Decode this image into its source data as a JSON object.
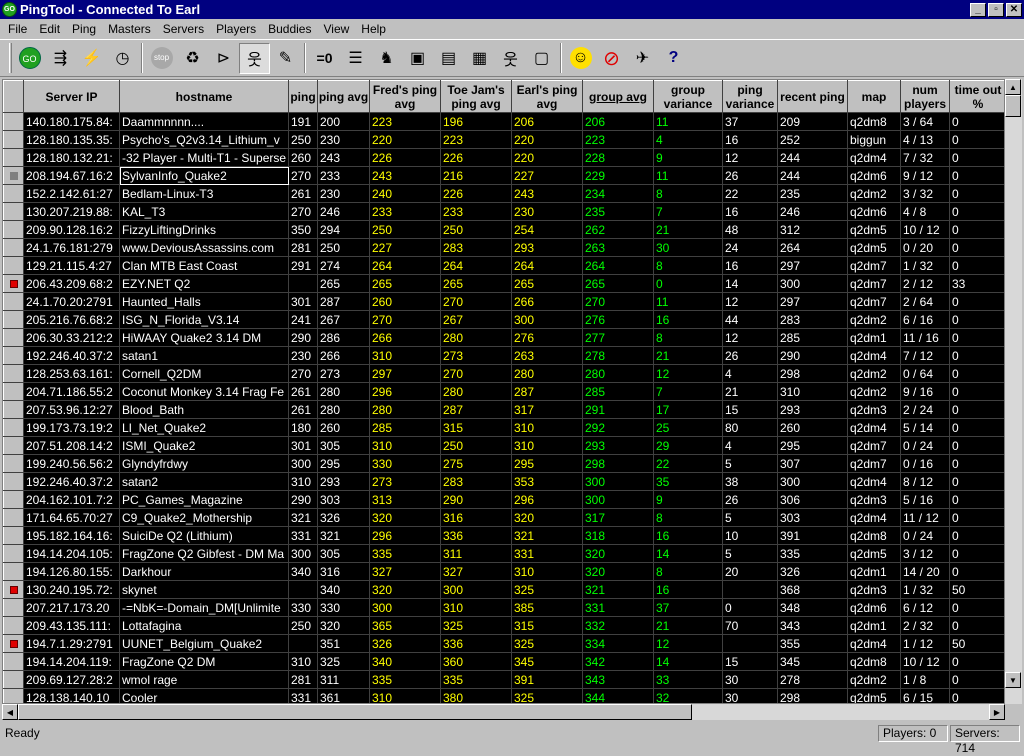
{
  "window": {
    "title": "PingTool - Connected To Earl",
    "app_icon": "GO",
    "minimize": "_",
    "maximize": "▫",
    "close": "✕"
  },
  "menu": [
    "File",
    "Edit",
    "Ping",
    "Masters",
    "Servers",
    "Players",
    "Buddies",
    "View",
    "Help"
  ],
  "toolbar": [
    {
      "name": "go-icon",
      "glyph": "GO"
    },
    {
      "name": "connect-network-icon",
      "glyph": "⇶"
    },
    {
      "name": "ping-lightning-icon",
      "glyph": "⚡"
    },
    {
      "name": "timer-icon",
      "glyph": "◷"
    },
    {
      "name": "stop-icon",
      "glyph": "stop"
    },
    {
      "name": "refresh-recycle-icon",
      "glyph": "♻"
    },
    {
      "name": "filter-icon",
      "glyph": "⊳"
    },
    {
      "name": "players-icon",
      "glyph": "웃"
    },
    {
      "name": "edit-pencil-icon",
      "glyph": "✎"
    },
    {
      "name": "zero-count-icon",
      "glyph": "=0"
    },
    {
      "name": "columns-icon",
      "glyph": "☰"
    },
    {
      "name": "binoculars-icon",
      "glyph": "♞"
    },
    {
      "name": "server-icon",
      "glyph": "▣"
    },
    {
      "name": "ping-server-icon",
      "glyph": "▤"
    },
    {
      "name": "window-icon",
      "glyph": "▦"
    },
    {
      "name": "group-players-icon",
      "glyph": "웃"
    },
    {
      "name": "monitor-icon",
      "glyph": "▢"
    },
    {
      "name": "smiley-icon",
      "glyph": "☺"
    },
    {
      "name": "no-buddy-icon",
      "glyph": "⊘"
    },
    {
      "name": "plane-icon",
      "glyph": "✈"
    },
    {
      "name": "help-icon",
      "glyph": "?"
    }
  ],
  "columns": [
    "",
    "Server IP",
    "hostname",
    "ping",
    "ping avg",
    "Fred's ping avg",
    "Toe Jam's ping avg",
    "Earl's ping avg",
    "group avg",
    "group variance",
    "ping variance",
    "recent ping",
    "map",
    "num players",
    "time out %"
  ],
  "rows": [
    [
      "",
      "140.180.175.84:",
      "Daammnnnn....",
      "191",
      "200",
      "223",
      "196",
      "206",
      "206",
      "11",
      "37",
      "209",
      "q2dm8",
      "3 / 64",
      "0"
    ],
    [
      "",
      "128.180.135.35:",
      "Psycho's_Q2v3.14_Lithium_v",
      "250",
      "230",
      "220",
      "223",
      "220",
      "223",
      "4",
      "16",
      "252",
      "biggun",
      "4 / 13",
      "0"
    ],
    [
      "",
      "128.180.132.21:",
      "-32 Player - Multi-T1 - Superse",
      "260",
      "243",
      "226",
      "226",
      "220",
      "228",
      "9",
      "12",
      "244",
      "q2dm4",
      "7 / 32",
      "0"
    ],
    [
      "cur",
      "208.194.67.16:2",
      "SylvanInfo_Quake2",
      "270",
      "233",
      "243",
      "216",
      "227",
      "229",
      "11",
      "26",
      "244",
      "q2dm6",
      "9 / 12",
      "0"
    ],
    [
      "",
      "152.2.142.61:27",
      "Bedlam-Linux-T3",
      "261",
      "230",
      "240",
      "226",
      "243",
      "234",
      "8",
      "22",
      "235",
      "q2dm2",
      "3 / 32",
      "0"
    ],
    [
      "",
      "130.207.219.88:",
      "KAL_T3",
      "270",
      "246",
      "233",
      "233",
      "230",
      "235",
      "7",
      "16",
      "246",
      "q2dm6",
      "4 / 8",
      "0"
    ],
    [
      "",
      "209.90.128.16:2",
      "FizzyLiftingDrinks",
      "350",
      "294",
      "250",
      "250",
      "254",
      "262",
      "21",
      "48",
      "312",
      "q2dm5",
      "10 / 12",
      "0"
    ],
    [
      "",
      "24.1.76.181:279",
      "www.DeviousAssassins.com",
      "281",
      "250",
      "227",
      "283",
      "293",
      "263",
      "30",
      "24",
      "264",
      "q2dm5",
      "0 / 20",
      "0"
    ],
    [
      "",
      "129.21.115.4:27",
      "Clan MTB East Coast",
      "291",
      "274",
      "264",
      "264",
      "264",
      "264",
      "8",
      "16",
      "297",
      "q2dm7",
      "1 / 32",
      "0"
    ],
    [
      "mark",
      "206.43.209.68:2",
      "EZY.NET Q2",
      "",
      "265",
      "265",
      "265",
      "265",
      "265",
      "0",
      "14",
      "300",
      "q2dm7",
      "2 / 12",
      "33"
    ],
    [
      "",
      "24.1.70.20:2791",
      "Haunted_Halls",
      "301",
      "287",
      "260",
      "270",
      "266",
      "270",
      "11",
      "12",
      "297",
      "q2dm7",
      "2 / 64",
      "0"
    ],
    [
      "",
      "205.216.76.68:2",
      "ISG_N_Florida_V3.14",
      "241",
      "267",
      "270",
      "267",
      "300",
      "276",
      "16",
      "44",
      "283",
      "q2dm2",
      "6 / 16",
      "0"
    ],
    [
      "",
      "206.30.33.212:2",
      "HiWAAY Quake2 3.14 DM",
      "290",
      "286",
      "266",
      "280",
      "276",
      "277",
      "8",
      "12",
      "285",
      "q2dm1",
      "11 / 16",
      "0"
    ],
    [
      "",
      "192.246.40.37:2",
      "satan1",
      "230",
      "266",
      "310",
      "273",
      "263",
      "278",
      "21",
      "26",
      "290",
      "q2dm4",
      "7 / 12",
      "0"
    ],
    [
      "",
      "128.253.63.161:",
      "Cornell_Q2DM",
      "270",
      "273",
      "297",
      "270",
      "280",
      "280",
      "12",
      "4",
      "298",
      "q2dm2",
      "0 / 64",
      "0"
    ],
    [
      "",
      "204.71.186.55:2",
      "Coconut Monkey 3.14 Frag Fe",
      "261",
      "280",
      "296",
      "280",
      "287",
      "285",
      "7",
      "21",
      "310",
      "q2dm2",
      "9 / 16",
      "0"
    ],
    [
      "",
      "207.53.96.12:27",
      "Blood_Bath",
      "261",
      "280",
      "280",
      "287",
      "317",
      "291",
      "17",
      "15",
      "293",
      "q2dm3",
      "2 / 24",
      "0"
    ],
    [
      "",
      "199.173.73.19:2",
      "LI_Net_Quake2",
      "180",
      "260",
      "285",
      "315",
      "310",
      "292",
      "25",
      "80",
      "260",
      "q2dm4",
      "5 / 14",
      "0"
    ],
    [
      "",
      "207.51.208.14:2",
      "ISMI_Quake2",
      "301",
      "305",
      "310",
      "250",
      "310",
      "293",
      "29",
      "4",
      "295",
      "q2dm7",
      "0 / 24",
      "0"
    ],
    [
      "",
      "199.240.56.56:2",
      "Glyndyfrdwy",
      "300",
      "295",
      "330",
      "275",
      "295",
      "298",
      "22",
      "5",
      "307",
      "q2dm7",
      "0 / 16",
      "0"
    ],
    [
      "",
      "192.246.40.37:2",
      "satan2",
      "310",
      "293",
      "273",
      "283",
      "353",
      "300",
      "35",
      "38",
      "300",
      "q2dm4",
      "8 / 12",
      "0"
    ],
    [
      "",
      "204.162.101.7:2",
      "PC_Games_Magazine",
      "290",
      "303",
      "313",
      "290",
      "296",
      "300",
      "9",
      "26",
      "306",
      "q2dm3",
      "5 / 16",
      "0"
    ],
    [
      "",
      "171.64.65.70:27",
      "C9_Quake2_Mothership",
      "321",
      "326",
      "320",
      "316",
      "320",
      "317",
      "8",
      "5",
      "303",
      "q2dm4",
      "11 / 12",
      "0"
    ],
    [
      "",
      "195.182.164.16:",
      "SuiciDe Q2 (Lithium)",
      "331",
      "321",
      "296",
      "336",
      "321",
      "318",
      "16",
      "10",
      "391",
      "q2dm8",
      "0 / 24",
      "0"
    ],
    [
      "",
      "194.14.204.105:",
      "FragZone Q2 Gibfest - DM Ma",
      "300",
      "305",
      "335",
      "311",
      "331",
      "320",
      "14",
      "5",
      "335",
      "q2dm5",
      "3 / 12",
      "0"
    ],
    [
      "",
      "194.126.80.155:",
      "Darkhour",
      "340",
      "316",
      "327",
      "327",
      "310",
      "320",
      "8",
      "20",
      "326",
      "q2dm1",
      "14 / 20",
      "0"
    ],
    [
      "mark",
      "130.240.195.72:",
      "skynet",
      "",
      "340",
      "320",
      "300",
      "325",
      "321",
      "16",
      "",
      "368",
      "q2dm3",
      "1 / 32",
      "50"
    ],
    [
      "",
      "207.217.173.20",
      "-=NbK=-Domain_DM[Unlimite",
      "330",
      "330",
      "300",
      "310",
      "385",
      "331",
      "37",
      "0",
      "348",
      "q2dm6",
      "6 / 12",
      "0"
    ],
    [
      "",
      "209.43.135.111:",
      "Lottafagina",
      "250",
      "320",
      "365",
      "325",
      "315",
      "332",
      "21",
      "70",
      "343",
      "q2dm1",
      "2 / 32",
      "0"
    ],
    [
      "mark",
      "194.7.1.29:2791",
      "UUNET_Belgium_Quake2",
      "",
      "351",
      "326",
      "336",
      "325",
      "334",
      "12",
      "",
      "355",
      "q2dm4",
      "1 / 12",
      "50"
    ],
    [
      "",
      "194.14.204.119:",
      "FragZone Q2 DM",
      "310",
      "325",
      "340",
      "360",
      "345",
      "342",
      "14",
      "15",
      "345",
      "q2dm8",
      "10 / 12",
      "0"
    ],
    [
      "",
      "209.69.127.28:2",
      "wmol rage",
      "281",
      "311",
      "335",
      "335",
      "391",
      "343",
      "33",
      "30",
      "278",
      "q2dm2",
      "1 / 8",
      "0"
    ],
    [
      "",
      "128.138.140.10",
      "Cooler",
      "331",
      "361",
      "310",
      "380",
      "325",
      "344",
      "32",
      "30",
      "298",
      "q2dm5",
      "6 / 15",
      "0"
    ]
  ],
  "status": {
    "left": "Ready",
    "players": "Players: 0",
    "servers": "Servers: 714"
  },
  "colors": {
    "titlebar": "#000080",
    "pings": "#ffff00",
    "group": "#00ff00",
    "grid_bg": "#000000"
  }
}
